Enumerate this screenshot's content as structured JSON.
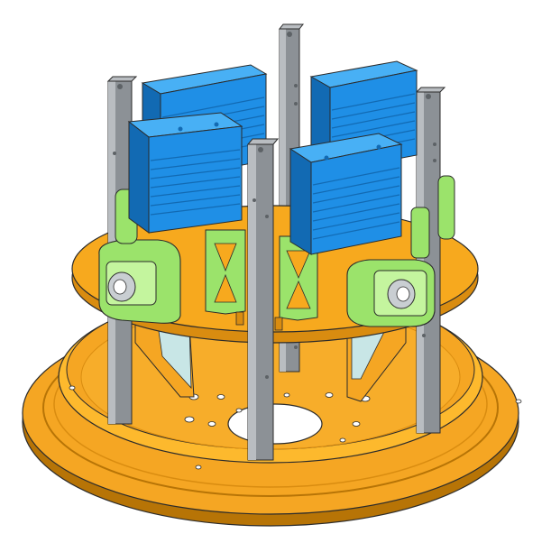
{
  "colors": {
    "background": "#ffffff",
    "base_ring": "#f5a623",
    "base_ring_light": "#fdb92d",
    "base_ring_dark": "#d98c10",
    "base_ring_shadow": "#b77406",
    "top_plate": "#f7a91e",
    "top_plate_edge": "#d98c10",
    "column": "#8c9196",
    "column_light": "#b9bdc1",
    "column_dark": "#5d6266",
    "servo_body": "#1f8fe6",
    "servo_light": "#48b0f5",
    "servo_dark": "#126ab3",
    "bracket": "#9be36b",
    "bracket_light": "#c4f59e",
    "bracket_dark": "#6cba3d",
    "clear_panel": "#c8e6e6",
    "bearing": "#c9ced2",
    "outline": "#2b2b2b"
  },
  "icons": {
    "servo": "servo-motor-icon",
    "column": "aluminum-extrusion-icon",
    "bearing": "bearing-icon"
  }
}
